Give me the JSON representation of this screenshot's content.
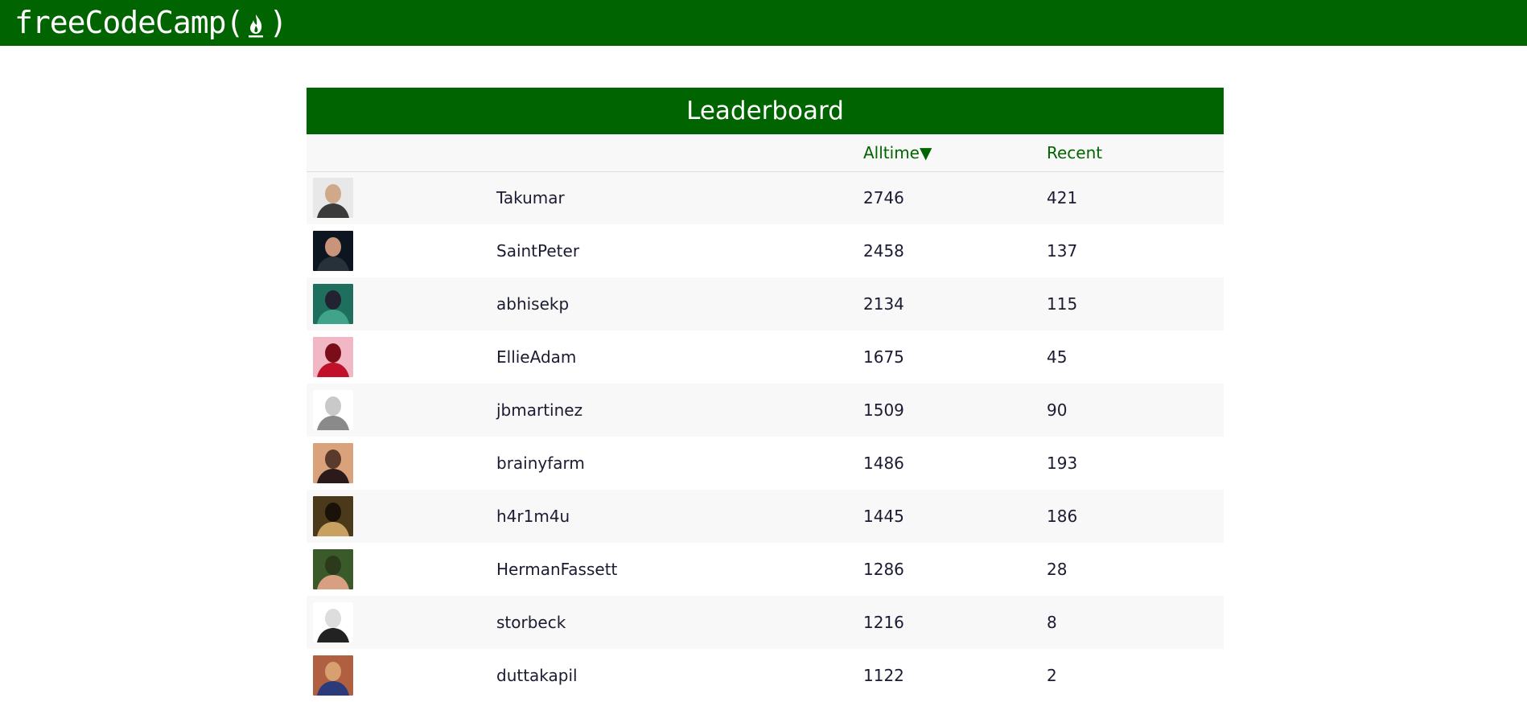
{
  "header": {
    "logo_text": "freeCodeCamp",
    "logo_paren_open": "(",
    "logo_paren_close": ")",
    "logo_icon": "flame-icon"
  },
  "board": {
    "title": "Leaderboard",
    "columns": {
      "avatar": "",
      "name": "",
      "alltime": "Alltime▼",
      "recent": "Recent"
    },
    "rows": [
      {
        "username": "Takumar",
        "alltime": "2746",
        "recent": "421",
        "avatar_colors": [
          "#e8e8e8",
          "#3a3a3a",
          "#cfa98a"
        ]
      },
      {
        "username": "SaintPeter",
        "alltime": "2458",
        "recent": "137",
        "avatar_colors": [
          "#0d1620",
          "#27313a",
          "#c9957a"
        ]
      },
      {
        "username": "abhisekp",
        "alltime": "2134",
        "recent": "115",
        "avatar_colors": [
          "#1f6f5f",
          "#3fa48a",
          "#222233"
        ]
      },
      {
        "username": "EllieAdam",
        "alltime": "1675",
        "recent": "45",
        "avatar_colors": [
          "#f1b7c4",
          "#c0102a",
          "#7a0d18"
        ]
      },
      {
        "username": "jbmartinez",
        "alltime": "1509",
        "recent": "90",
        "avatar_colors": [
          "#ffffff",
          "#8a8a8a",
          "#c9c9c9"
        ]
      },
      {
        "username": "brainyfarm",
        "alltime": "1486",
        "recent": "193",
        "avatar_colors": [
          "#d9a27a",
          "#2a1a1a",
          "#5a3a2a"
        ]
      },
      {
        "username": "h4r1m4u",
        "alltime": "1445",
        "recent": "186",
        "avatar_colors": [
          "#4a3a1a",
          "#c8a060",
          "#1a1208"
        ]
      },
      {
        "username": "HermanFassett",
        "alltime": "1286",
        "recent": "28",
        "avatar_colors": [
          "#3a5a2a",
          "#d8a080",
          "#2a3a1a"
        ]
      },
      {
        "username": "storbeck",
        "alltime": "1216",
        "recent": "8",
        "avatar_colors": [
          "#ffffff",
          "#222222",
          "#dddddd"
        ]
      },
      {
        "username": "duttakapil",
        "alltime": "1122",
        "recent": "2",
        "avatar_colors": [
          "#b06040",
          "#2a3a7a",
          "#d8a070"
        ]
      }
    ]
  },
  "colors": {
    "brand_green": "#006400",
    "row_alt": "#f8f8f8",
    "text": "#1b1b32"
  }
}
